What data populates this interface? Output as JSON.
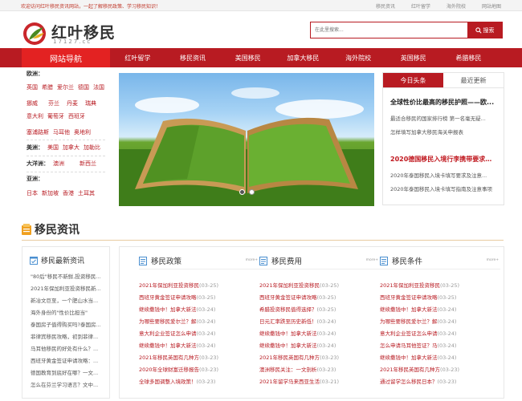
{
  "topbar": {
    "welcome": "欢迎访问红叶移民资讯网站，一起了解移民政策、学习移民知识！",
    "links": [
      "移民资讯",
      "红叶留学",
      "海外院校",
      "网站地图"
    ]
  },
  "header": {
    "logo_text": "红叶移民",
    "logo_sub": "17127.cc",
    "search_placeholder": "在此里搜索...",
    "search_button": "搜索"
  },
  "nav": {
    "guide": "网站导航",
    "items": [
      "红叶留学",
      "移民资讯",
      "美国移民",
      "加拿大移民",
      "海外院校",
      "英国移民",
      "希腊移民"
    ]
  },
  "regions": {
    "europe_title": "欧洲：",
    "europe_rows": [
      [
        "英国",
        "希腊",
        "爱尔兰",
        "德国",
        "法国"
      ],
      [
        "挪威",
        "芬兰",
        "丹麦",
        "瑞典"
      ],
      [
        "意大利",
        "葡萄牙",
        "西班牙"
      ],
      [
        "塞浦路斯",
        "马耳他",
        "奥地利"
      ]
    ],
    "america_title": "美洲：",
    "america_row": [
      "美国",
      "加拿大",
      "加勒比"
    ],
    "oceania_title": "大洋洲：",
    "oceania_row": [
      "澳洲",
      "新西兰"
    ],
    "asia_title": "亚洲：",
    "asia_row": [
      "日本",
      "新加坡",
      "香港",
      "土耳其"
    ]
  },
  "news": {
    "tabs": [
      "今日头条",
      "最近更新"
    ],
    "headline1": "全球性价比最高的移民护照——欧...",
    "subs1": [
      "最适合移民的国家排行榜 第一名毫无疑...",
      "怎样填写加拿大移民海关申报表"
    ],
    "headline2": "2020德国移民入境行李携带要求一...",
    "subs2": [
      "2020年泰国移民入境卡填写要求及注意...",
      "2020年泰国移民入境卡填写指南及注意事项"
    ]
  },
  "section": {
    "title": "移民资讯"
  },
  "latest": {
    "title": "移民最新资讯",
    "items": [
      "\"80后\"移民不新鲜,投资移民...",
      "2021年保加利亚投资移民新...",
      "新冶文巨至，一个肥山水当...",
      "海外身份的\"性价比担当\"",
      "泰国房子值得购买吗?泰国房...",
      "菲律宾移民攻略，初到菲律...",
      "马耳他移民的好处有什么？...",
      "西班牙黄金签证申请攻略：...",
      "德国教育到底好在哪？一文...",
      "怎么在芬兰学习语言？文中..."
    ]
  },
  "columns": [
    {
      "title": "移民政策",
      "more": "more+",
      "rows": [
        {
          "t": "2021年保加利亚投资移民",
          "d": "(03-25)"
        },
        {
          "t": "西班牙黄金签证申请攻略",
          "d": "(03-25)"
        },
        {
          "t": "继续撒钱中！加拿大新法",
          "d": "(03-24)"
        },
        {
          "t": "为哪些要移民爱尔兰？解",
          "d": "(03-24)"
        },
        {
          "t": "意大利企业签证怎么申请",
          "d": "(03-24)"
        },
        {
          "t": "继续撒钱中！加拿大新法",
          "d": "(03-24)"
        },
        {
          "t": "2021年移民英国有几种方",
          "d": "(03-23)"
        },
        {
          "t": "2020年全球财富迁移报告",
          "d": "(03-23)"
        },
        {
          "t": "全球多国调整入境政策！",
          "d": "(03-23)"
        }
      ]
    },
    {
      "title": "移民费用",
      "more": "more+",
      "rows": [
        {
          "t": "2021年保加利亚投资移民",
          "d": "(03-25)"
        },
        {
          "t": "西班牙黄金签证申请攻略",
          "d": "(03-25)"
        },
        {
          "t": "希腊投资移民值得选择？",
          "d": "(03-25)"
        },
        {
          "t": "日元汇率跌至历史新低！",
          "d": "(03-24)"
        },
        {
          "t": "继续撒钱中！加拿大新法",
          "d": "(03-24)"
        },
        {
          "t": "继续撒钱中！加拿大新法",
          "d": "(03-24)"
        },
        {
          "t": "2021年移民英国有几种方",
          "d": "(03-23)"
        },
        {
          "t": "澳洲移民关注：一文剖析",
          "d": "(03-23)"
        },
        {
          "t": "2021年留学马来西亚生活",
          "d": "(03-21)"
        }
      ]
    },
    {
      "title": "移民条件",
      "more": "more+",
      "rows": [
        {
          "t": "2021年保加利亚投资移民",
          "d": "(03-25)"
        },
        {
          "t": "西班牙黄金签证申请攻略",
          "d": "(03-25)"
        },
        {
          "t": "继续撒钱中！加拿大新法",
          "d": "(03-24)"
        },
        {
          "t": "为哪些要移民爱尔兰？解",
          "d": "(03-24)"
        },
        {
          "t": "意大利企业签证怎么申请",
          "d": "(03-24)"
        },
        {
          "t": "怎么申请马耳他签证？马",
          "d": "(03-24)"
        },
        {
          "t": "继续撒钱中！加拿大新法",
          "d": "(03-24)"
        },
        {
          "t": "2021年移民英国有几种方",
          "d": "(03-23)"
        },
        {
          "t": "通过留学怎么移民日本？",
          "d": "(03-23)"
        }
      ]
    }
  ],
  "colors": {
    "brand_red": "#b81b22",
    "nav_highlight": "#e32222"
  }
}
